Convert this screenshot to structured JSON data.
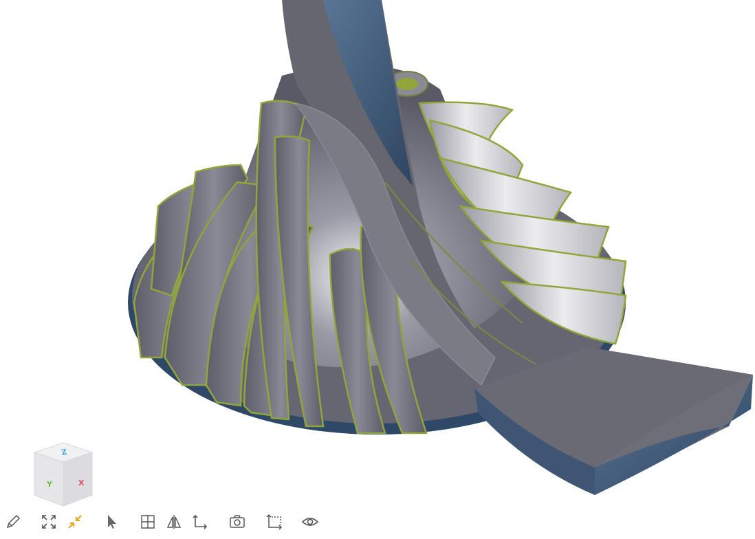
{
  "viewer": {
    "model": "impeller-blade-assembly",
    "colors": {
      "background": "#ffffff",
      "blade_surface": "#6c6c78",
      "blade_light": "#d8d8dd",
      "edge_highlight": "#8fa63a",
      "section_face": "#3e5673"
    }
  },
  "viewcube": {
    "faces": {
      "top": "Z",
      "left": "Y",
      "right": "X"
    },
    "colors": {
      "z": "#4aa8e0",
      "y": "#5fbf3f",
      "x": "#e25252"
    }
  },
  "toolbar": {
    "tools": [
      {
        "icon": "pencil-icon"
      },
      {
        "icon": "fit-view-icon"
      },
      {
        "icon": "shrink-view-icon"
      },
      {
        "icon": "select-pointer-icon"
      },
      {
        "icon": "section-plane-icon"
      },
      {
        "icon": "mirror-icon"
      },
      {
        "icon": "axis-icon"
      },
      {
        "icon": "camera-icon"
      },
      {
        "icon": "measure-icon"
      },
      {
        "icon": "visibility-eye-icon"
      }
    ],
    "accent_color": "#e6a417"
  }
}
